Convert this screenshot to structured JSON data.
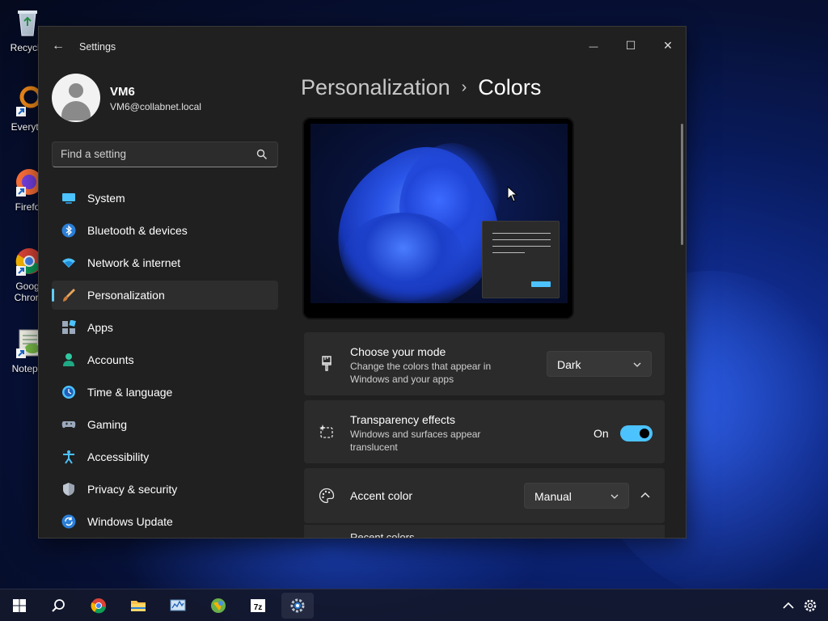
{
  "desktop": {
    "icons": [
      {
        "label": "Recycle"
      },
      {
        "label": "Everyth"
      },
      {
        "label": "Firefo"
      },
      {
        "label": "Goog Chron"
      },
      {
        "label": "Notepa"
      }
    ]
  },
  "window": {
    "title": "Settings",
    "back_glyph": "←",
    "min_glyph": "—",
    "max_glyph": "☐",
    "close_glyph": "✕"
  },
  "user": {
    "name": "VM6",
    "email": "VM6@collabnet.local"
  },
  "search": {
    "placeholder": "Find a setting"
  },
  "nav": {
    "items": [
      {
        "label": "System",
        "icon": "system-icon"
      },
      {
        "label": "Bluetooth & devices",
        "icon": "bluetooth-icon"
      },
      {
        "label": "Network & internet",
        "icon": "network-icon"
      },
      {
        "label": "Personalization",
        "icon": "brush-icon",
        "active": true
      },
      {
        "label": "Apps",
        "icon": "apps-icon"
      },
      {
        "label": "Accounts",
        "icon": "accounts-icon"
      },
      {
        "label": "Time & language",
        "icon": "clock-icon"
      },
      {
        "label": "Gaming",
        "icon": "gamepad-icon"
      },
      {
        "label": "Accessibility",
        "icon": "accessibility-icon"
      },
      {
        "label": "Privacy & security",
        "icon": "shield-icon"
      },
      {
        "label": "Windows Update",
        "icon": "update-icon"
      }
    ]
  },
  "breadcrumb": {
    "parent": "Personalization",
    "separator": "›",
    "current": "Colors"
  },
  "mode_card": {
    "title": "Choose your mode",
    "description": "Change the colors that appear in Windows and your apps",
    "value": "Dark"
  },
  "transparency_card": {
    "title": "Transparency effects",
    "description": "Windows and surfaces appear translucent",
    "state_label": "On",
    "enabled": true
  },
  "accent_card": {
    "title": "Accent color",
    "value": "Manual",
    "expanded": true
  },
  "recent_colors": {
    "title": "Recent colors"
  },
  "colors": {
    "accent": "#4cc2ff",
    "window_bg": "#202020",
    "card_bg": "#2b2b2b",
    "active_indicator": "#60cdff"
  }
}
